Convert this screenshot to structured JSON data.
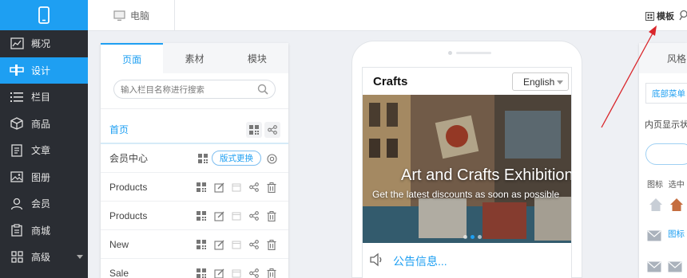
{
  "nav": {
    "items": [
      {
        "label": "概况",
        "icon": "chart-icon"
      },
      {
        "label": "设计",
        "icon": "design-icon"
      },
      {
        "label": "栏目",
        "icon": "list-icon"
      },
      {
        "label": "商品",
        "icon": "box-icon"
      },
      {
        "label": "文章",
        "icon": "document-icon"
      },
      {
        "label": "图册",
        "icon": "image-icon"
      },
      {
        "label": "会员",
        "icon": "user-icon"
      },
      {
        "label": "商城",
        "icon": "clipboard-icon"
      },
      {
        "label": "高级",
        "icon": "grid-icon"
      }
    ],
    "active_index": 1
  },
  "topbar": {
    "device_label": "电脑",
    "template_label": "模板"
  },
  "panel": {
    "tabs": [
      "页面",
      "素材",
      "模块"
    ],
    "active_tab": 0,
    "search_placeholder": "输入栏目名称进行搜索",
    "rows": [
      {
        "label": "首页"
      },
      {
        "label": "会员中心",
        "button": "版式更换"
      },
      {
        "label": "Products"
      },
      {
        "label": "Products"
      },
      {
        "label": "New"
      },
      {
        "label": "Sale"
      }
    ]
  },
  "phone": {
    "logo": "Crafts",
    "language": "English",
    "hero_title": "Art and Crafts Exhibition",
    "hero_subtitle": "Get the latest discounts as soon as possible",
    "notice_text": "公告信息..."
  },
  "right_panel": {
    "title": "风格",
    "sub_tab": "底部菜单",
    "inner_label": "内页显示状",
    "col_icon": "图标",
    "col_selected": "选中",
    "row_label": "图标"
  },
  "colors": {
    "accent": "#1e9ff2",
    "nav_bg": "#2a2d33",
    "annotation": "#d9252a"
  }
}
